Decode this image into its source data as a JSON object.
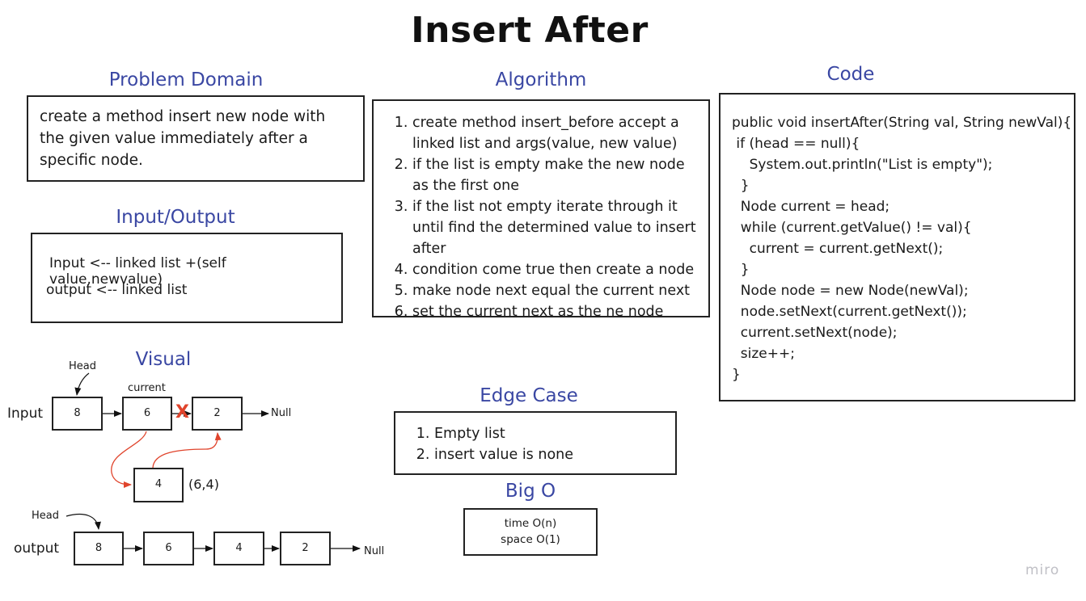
{
  "title": "Insert After",
  "problem_domain": {
    "heading": "Problem Domain",
    "text": "create a method insert new node with the given value immediately after a specific node."
  },
  "input_output": {
    "heading": "Input/Output",
    "input": "Input <-- linked list +(self value,newvalue)",
    "output": "output <-- linked list"
  },
  "algorithm": {
    "heading": "Algorithm",
    "steps": [
      "create method insert_before accept a linked list and args(value, new value)",
      "if the list is empty make the new node as the first one",
      "if the list not empty iterate through it until find the determined value to insert after",
      "condition come true then create a node",
      "make node next equal the current next",
      "set the current next as the ne node"
    ]
  },
  "code": {
    "heading": "Code",
    "lines": [
      "public void insertAfter(String val, String newVal){",
      " if (head == null){",
      "    System.out.println(\"List is empty\");",
      "  }",
      "  Node current = head;",
      "  while (current.getValue() != val){",
      "    current = current.getNext();",
      "  }",
      "  Node node = new Node(newVal);",
      "  node.setNext(current.getNext());",
      "  current.setNext(node);",
      "  size++;",
      "}"
    ]
  },
  "visual": {
    "heading": "Visual",
    "input_label": "Input",
    "output_label": "output",
    "head_label": "Head",
    "current_label": "current",
    "null_label": "Null",
    "cross": "X",
    "input_nodes": [
      "8",
      "6",
      "2"
    ],
    "new_node": "4",
    "new_node_args": "(6,4)",
    "output_nodes": [
      "8",
      "6",
      "4",
      "2"
    ]
  },
  "edge_case": {
    "heading": "Edge Case",
    "items": [
      "Empty list",
      "insert value is none"
    ]
  },
  "big_o": {
    "heading": "Big O",
    "time": "time O(n)",
    "space": "space O(1)"
  },
  "watermark": "miro",
  "colors": {
    "heading": "#3a47a3",
    "red_arrow": "#e0442c"
  }
}
